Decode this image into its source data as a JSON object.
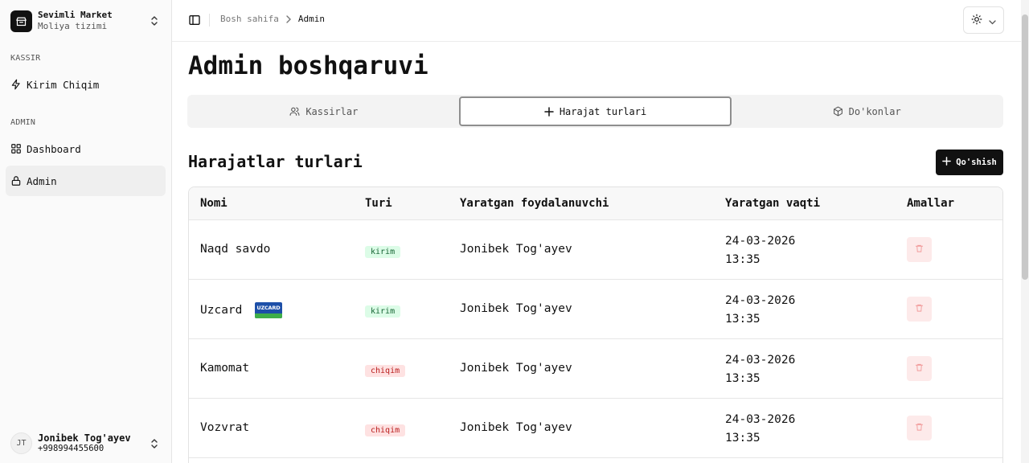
{
  "sidebar": {
    "brand_name": "Sevimli Market",
    "brand_sub": "Moliya tizimi",
    "groups": [
      {
        "label": "KASSIR"
      },
      {
        "label": "ADMIN"
      }
    ],
    "items": [
      {
        "label": "Kirim Chiqim",
        "icon": "zap-icon"
      },
      {
        "label": "Dashboard",
        "icon": "grid-icon"
      },
      {
        "label": "Admin",
        "icon": "lock-icon",
        "active": true
      }
    ],
    "user": {
      "initials": "JT",
      "name": "Jonibek Tog'ayev",
      "phone": "+998994455600"
    }
  },
  "header": {
    "breadcrumb_home": "Bosh sahifa",
    "breadcrumb_current": "Admin"
  },
  "main": {
    "title": "Admin boshqaruvi",
    "tabs": [
      {
        "label": "Kassirlar",
        "icon": "users-icon"
      },
      {
        "label": "Harajat turlari",
        "icon": "plus-icon",
        "active": true
      },
      {
        "label": "Do'konlar",
        "icon": "box-icon"
      }
    ],
    "section_title": "Harajatlar turlari",
    "add_label": "Qo'shish",
    "table": {
      "headers": [
        "Nomi",
        "Turi",
        "Yaratgan foydalanuvchi",
        "Yaratgan vaqti",
        "Amallar"
      ],
      "rows": [
        {
          "name": "Naqd savdo",
          "type": "kirim",
          "user": "Jonibek Tog'ayev",
          "date": "24-03-2026",
          "time": "13:35"
        },
        {
          "name": "Uzcard",
          "type": "kirim",
          "user": "Jonibek Tog'ayev",
          "date": "24-03-2026",
          "time": "13:35",
          "logo_text": "UZCARD"
        },
        {
          "name": "Kamomat",
          "type": "chiqim",
          "user": "Jonibek Tog'ayev",
          "date": "24-03-2026",
          "time": "13:35"
        },
        {
          "name": "Vozvrat",
          "type": "chiqim",
          "user": "Jonibek Tog'ayev",
          "date": "24-03-2026",
          "time": "13:35"
        }
      ]
    }
  },
  "colors": {
    "kirim_bg": "#dcfce7",
    "kirim_text": "#166534",
    "chiqim_bg": "#fee2e2",
    "chiqim_text": "#b91c1c",
    "primary": "#111111"
  }
}
